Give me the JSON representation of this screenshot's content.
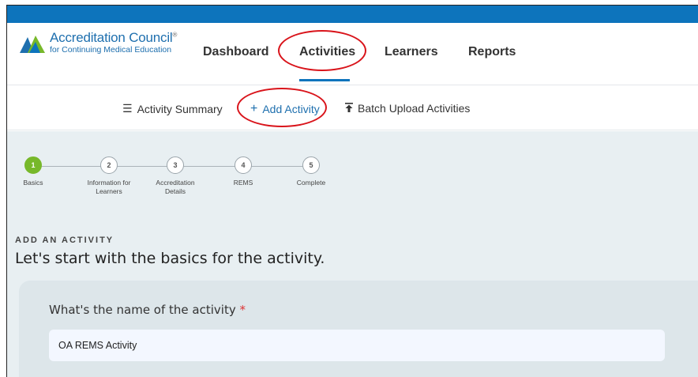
{
  "logo": {
    "title": "Accreditation Council",
    "trademark": "®",
    "subtitle": "for Continuing Medical Education"
  },
  "nav": {
    "items": [
      {
        "label": "Dashboard"
      },
      {
        "label": "Activities",
        "active": true
      },
      {
        "label": "Learners"
      },
      {
        "label": "Reports"
      }
    ]
  },
  "subnav": {
    "summary_label": "Activity Summary",
    "add_label": "Add Activity",
    "batch_label": "Batch Upload Activities"
  },
  "stepper": {
    "steps": [
      {
        "number": "1",
        "label": "Basics",
        "current": true
      },
      {
        "number": "2",
        "label": "Information for Learners"
      },
      {
        "number": "3",
        "label": "Accreditation Details"
      },
      {
        "number": "4",
        "label": "REMS"
      },
      {
        "number": "5",
        "label": "Complete"
      }
    ]
  },
  "form": {
    "eyebrow": "ADD AN ACTIVITY",
    "heading": "Let's start with the basics for the activity.",
    "question": "What's the name of the activity",
    "required_marker": "*",
    "name_value": "OA REMS Activity"
  },
  "colors": {
    "brand_blue": "#0d74bc",
    "step_active": "#77b82a",
    "annotation_red": "#d9141b",
    "content_bg": "#e8eff2"
  }
}
